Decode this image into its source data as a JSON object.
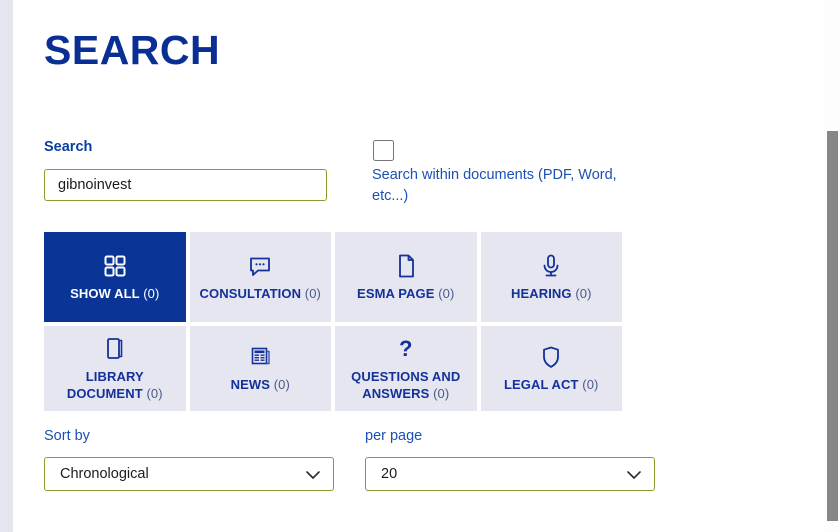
{
  "page": {
    "title": "SEARCH"
  },
  "search": {
    "label": "Search",
    "value": "gibnoinvest",
    "placeholder": "",
    "within_documents_label": "Search within documents (PDF, Word, etc...)",
    "within_documents_checked": false
  },
  "categories": [
    {
      "label": "SHOW ALL",
      "count": "(0)",
      "icon": "grid-icon",
      "active": true
    },
    {
      "label": "CONSULTATION",
      "count": "(0)",
      "icon": "speech-bubble-icon",
      "active": false
    },
    {
      "label": "ESMA PAGE",
      "count": "(0)",
      "icon": "document-page-icon",
      "active": false
    },
    {
      "label": "HEARING",
      "count": "(0)",
      "icon": "microphone-icon",
      "active": false
    },
    {
      "label": "LIBRARY DOCUMENT",
      "count": "(0)",
      "icon": "book-icon",
      "active": false
    },
    {
      "label": "NEWS",
      "count": "(0)",
      "icon": "newspaper-icon",
      "active": false
    },
    {
      "label": "QUESTIONS AND ANSWERS",
      "count": "(0)",
      "icon": "question-mark-icon",
      "active": false
    },
    {
      "label": "LEGAL ACT",
      "count": "(0)",
      "icon": "shield-icon",
      "active": false
    }
  ],
  "sort": {
    "label": "Sort by",
    "value": "Chronological",
    "options": [
      "Chronological"
    ]
  },
  "per_page": {
    "label": "per page",
    "value": "20",
    "options": [
      "20"
    ]
  },
  "colors": {
    "brand_blue": "#0a2f94",
    "active_tile": "#0a3596",
    "tile_bg": "#e6e6f0",
    "field_border": "#8d9b2e",
    "link_blue": "#1b50b4",
    "rail_bg": "#e5e5ef"
  }
}
